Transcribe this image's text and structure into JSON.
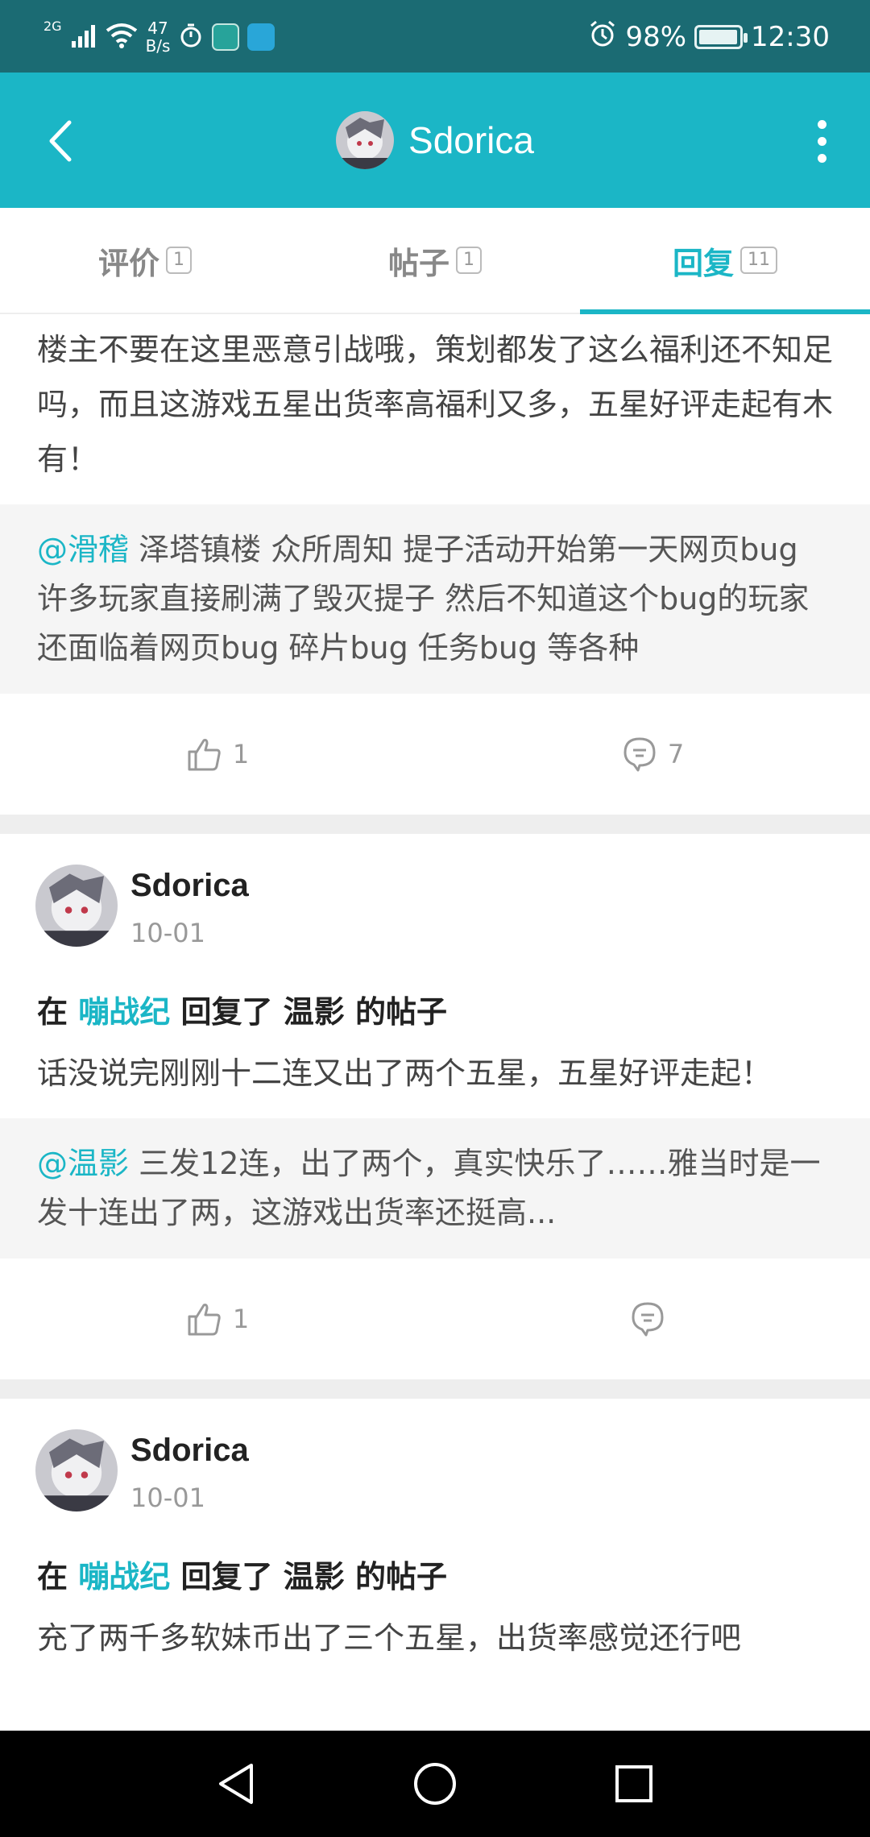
{
  "status_bar": {
    "signal_label": "2G",
    "net_speed_value": "47",
    "net_speed_unit": "B/s",
    "alarm_icon": "alarm-icon",
    "battery_percent": "98%",
    "battery_level": 0.98,
    "time": "12:30"
  },
  "app_bar": {
    "title": "Sdorica",
    "back_icon": "back-arrow-icon",
    "more_icon": "more-vertical-icon"
  },
  "tabs": [
    {
      "label": "评价",
      "count": "1",
      "active": false
    },
    {
      "label": "帖子",
      "count": "1",
      "active": false
    },
    {
      "label": "回复",
      "count": "11",
      "active": true
    }
  ],
  "colors": {
    "accent": "#1bb6c6",
    "status_bar": "#1b6b73"
  },
  "feed": [
    {
      "partial": true,
      "body": "楼主不要在这里恶意引战哦，策划都发了这么福利还不知足吗，而且这游戏五星出货率高福利又多，五星好评走起有木有！",
      "quote_at": "@滑稽",
      "quote_text": " 泽塔镇楼 众所周知 提子活动开始第一天网页bug 许多玩家直接刷满了毁灭提子 然后不知道这个bug的玩家还面临着网页bug 碎片bug 任务bug 等各种",
      "likes": "1",
      "comments": "7"
    },
    {
      "user": "Sdorica",
      "date": "10-01",
      "meta_prefix": "在 ",
      "meta_game": "嘣战纪",
      "meta_suffix": " 回复了 温影 的帖子",
      "body": "话没说完刚刚十二连又出了两个五星，五星好评走起！",
      "quote_at": "@温影",
      "quote_text": " 三发12连，出了两个，真实快乐了……雅当时是一发十连出了两，这游戏出货率还挺高...",
      "likes": "1",
      "comments": ""
    },
    {
      "user": "Sdorica",
      "date": "10-01",
      "meta_prefix": "在 ",
      "meta_game": "嘣战纪",
      "meta_suffix": " 回复了 温影 的帖子",
      "body": "充了两千多软妹币出了三个五星，出货率感觉还行吧"
    }
  ],
  "nav_bar": {
    "back": "nav-back-icon",
    "home": "nav-home-icon",
    "recents": "nav-recents-icon"
  }
}
